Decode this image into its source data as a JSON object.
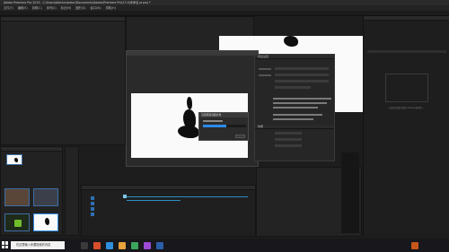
{
  "window": {
    "title": "Adobe Premiere Pro 2019 - C:\\Users\\Administrator\\Documents\\Adobe\\Premiere Pro\\13.0\\未命名.prproj *"
  },
  "menu": [
    "文件(F)",
    "编辑(E)",
    "剪辑(C)",
    "序列(S)",
    "标记(M)",
    "图形(G)",
    "窗口(W)",
    "帮助(H)"
  ],
  "dialog": {
    "title": "渲染所需音频文件",
    "progress": 0.55,
    "cancel_label": "取消"
  },
  "export_panel": {
    "title": "导出设置",
    "section": "效果"
  },
  "right_panel": {
    "hint": "在此处查找已使用 Adobe 版本的 ..."
  },
  "taskbar": {
    "search_placeholder": "在这里输入你要搜索的内容",
    "time": "",
    "date": ""
  },
  "colors": {
    "accent": "#2d8ceb",
    "panel_bg": "#232323",
    "taskbar": "#17171c"
  }
}
